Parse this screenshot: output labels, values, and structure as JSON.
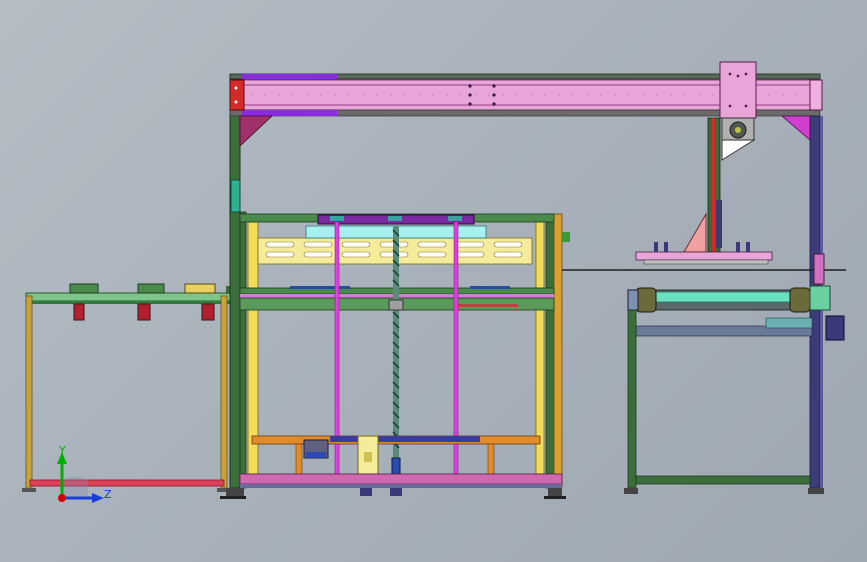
{
  "triad": {
    "y_label": "Y",
    "z_label": "Z",
    "y_color": "#00b000",
    "z_color": "#1a3fd6",
    "x_color": "#d40000"
  },
  "colors": {
    "background": "#a9b2bb",
    "gantry_beam": "#e8a6d8",
    "gantry_accent": "#8a2be2",
    "frame_green": "#2d6b2d",
    "frame_yellow": "#f2dc5a",
    "frame_orange": "#e38a2a",
    "rod_magenta": "#e040e0",
    "red_end_cap": "#d42a2a",
    "cyan_panel": "#a8f0f0",
    "left_table": "#c9a33a"
  }
}
